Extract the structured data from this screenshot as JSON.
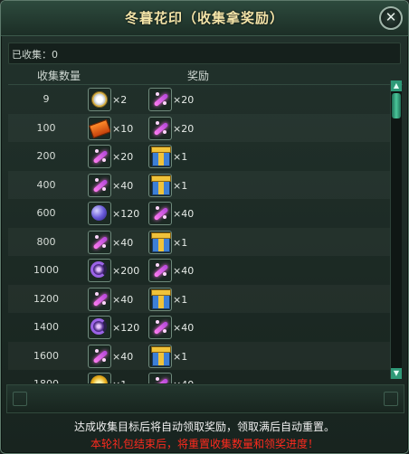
{
  "window": {
    "title": "冬暮花印（收集拿奖励）",
    "close_icon": "close-icon"
  },
  "collected": {
    "label": "已收集：0"
  },
  "columns": {
    "count": "收集数量",
    "reward": "奖励"
  },
  "rows": [
    {
      "count": "9",
      "items": [
        {
          "icon": "pocket-watch-icon",
          "qty": "×2"
        },
        {
          "icon": "feather-icon",
          "qty": "×20"
        }
      ]
    },
    {
      "count": "100",
      "items": [
        {
          "icon": "ticket-icon",
          "qty": "×10"
        },
        {
          "icon": "feather-icon",
          "qty": "×20"
        }
      ]
    },
    {
      "count": "200",
      "items": [
        {
          "icon": "feather-icon",
          "qty": "×20"
        },
        {
          "icon": "gift-box-icon",
          "qty": "×1"
        }
      ]
    },
    {
      "count": "400",
      "items": [
        {
          "icon": "feather-icon",
          "qty": "×40"
        },
        {
          "icon": "gift-box-icon",
          "qty": "×1"
        }
      ]
    },
    {
      "count": "600",
      "items": [
        {
          "icon": "crystal-orb-icon",
          "qty": "×120"
        },
        {
          "icon": "feather-icon",
          "qty": "×40"
        }
      ]
    },
    {
      "count": "800",
      "items": [
        {
          "icon": "feather-icon",
          "qty": "×40"
        },
        {
          "icon": "gift-box-icon",
          "qty": "×1"
        }
      ]
    },
    {
      "count": "1000",
      "items": [
        {
          "icon": "purple-swirl-icon",
          "qty": "×200"
        },
        {
          "icon": "feather-icon",
          "qty": "×40"
        }
      ]
    },
    {
      "count": "1200",
      "items": [
        {
          "icon": "feather-icon",
          "qty": "×40"
        },
        {
          "icon": "gift-box-icon",
          "qty": "×1"
        }
      ]
    },
    {
      "count": "1400",
      "items": [
        {
          "icon": "purple-swirl-icon",
          "qty": "×120"
        },
        {
          "icon": "feather-icon",
          "qty": "×40"
        }
      ]
    },
    {
      "count": "1600",
      "items": [
        {
          "icon": "feather-icon",
          "qty": "×40"
        },
        {
          "icon": "gift-box-icon",
          "qty": "×1"
        }
      ]
    },
    {
      "count": "1800",
      "items": [
        {
          "icon": "gold-coin-icon",
          "qty": "×1"
        },
        {
          "icon": "feather-icon",
          "qty": "×40"
        }
      ]
    }
  ],
  "scrollbar": {
    "up_icon": "scroll-up-icon",
    "down_icon": "scroll-down-icon"
  },
  "footer": {
    "line1": "达成收集目标后将自动领取奖励，领取满后自动重置。",
    "line2": "本轮礼包结束后，将重置收集数量和领奖进度！"
  },
  "colors": {
    "title": "#f3e4a8",
    "warning": "#ff2a1e",
    "accent": "#2f9a78"
  }
}
